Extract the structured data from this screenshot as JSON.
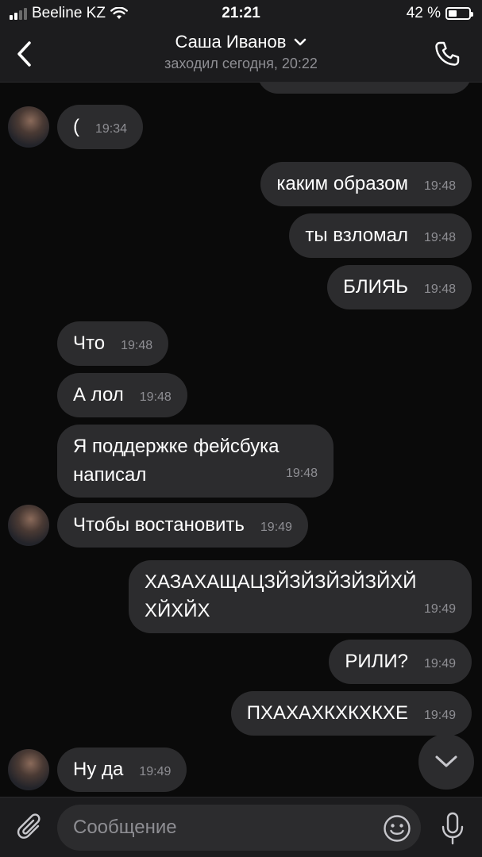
{
  "status_bar": {
    "carrier": "Beeline KZ",
    "time": "21:21",
    "battery": "42 %",
    "battery_level": 0.42
  },
  "header": {
    "contact_name": "Саша Иванов",
    "last_seen": "заходил сегодня, 20:22",
    "icons": {
      "back": "chevron-left-icon",
      "dropdown": "chevron-down-icon",
      "call": "phone-icon"
    }
  },
  "messages": [
    {
      "direction": "in",
      "text": "(",
      "time": "19:34"
    },
    {
      "direction": "out",
      "text": "каким образом",
      "time": "19:48"
    },
    {
      "direction": "out",
      "text": "ты взломал",
      "time": "19:48"
    },
    {
      "direction": "out",
      "text": "БЛИЯЬ",
      "time": "19:48"
    },
    {
      "direction": "in",
      "text": "Что",
      "time": "19:48"
    },
    {
      "direction": "in",
      "text": "А лол",
      "time": "19:48"
    },
    {
      "direction": "in",
      "lines": [
        "Я поддержке фейсбука",
        "написал"
      ],
      "time": "19:48"
    },
    {
      "direction": "in",
      "text": "Чтобы востановить",
      "time": "19:49"
    },
    {
      "direction": "out",
      "lines": [
        "ХАЗАХАЩАЦЗЙЗЙЗЙЗЙЗЙХЙ",
        "ХЙХЙХ"
      ],
      "time": "19:49"
    },
    {
      "direction": "out",
      "text": "РИЛИ?",
      "time": "19:49"
    },
    {
      "direction": "out",
      "text": "ПХАХАХКХКХКХЕ",
      "time": "19:49"
    },
    {
      "direction": "in",
      "text": "Ну да",
      "time": "19:49"
    }
  ],
  "input": {
    "placeholder": "Сообщение",
    "value": "",
    "icons": {
      "attach": "paperclip-icon",
      "emoji": "emoji-icon",
      "mic": "microphone-icon",
      "scroll": "chevron-down-icon"
    }
  },
  "colors": {
    "background": "#0a0a0a",
    "bar": "#1c1c1e",
    "bubble": "#2c2c2e",
    "secondary_text": "#8e8e93"
  }
}
